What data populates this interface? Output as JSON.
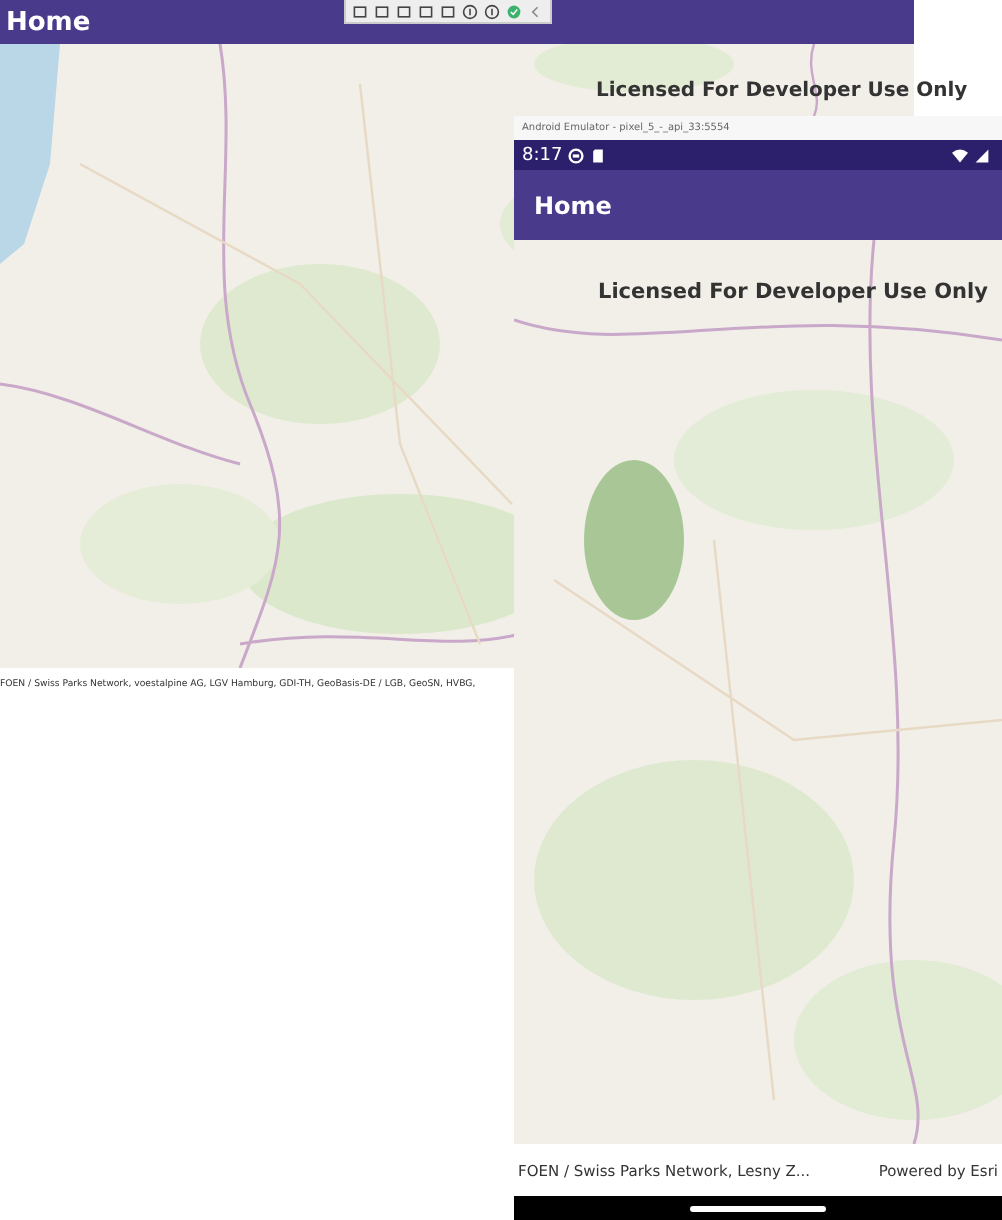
{
  "desktop_window": {
    "app_bar": {
      "title": "Home"
    },
    "map": {
      "watermark": "Licensed For Developer Use Only",
      "attribution": "FOEN / Swiss Parks Network, voestalpine AG, LGV Hamburg, GDI-TH, GeoBasis-DE / LGB, GeoSN, HVBG,"
    }
  },
  "emulator": {
    "title": "Android Emulator - pixel_5_-_api_33:5554",
    "status_bar": {
      "time": "8:17"
    },
    "app_bar": {
      "title": "Home"
    },
    "map": {
      "watermark": "Licensed For Developer Use Only",
      "attribution": "FOEN / Swiss Parks Network, Lesny Z...",
      "powered_by": "Powered by Esri"
    }
  }
}
